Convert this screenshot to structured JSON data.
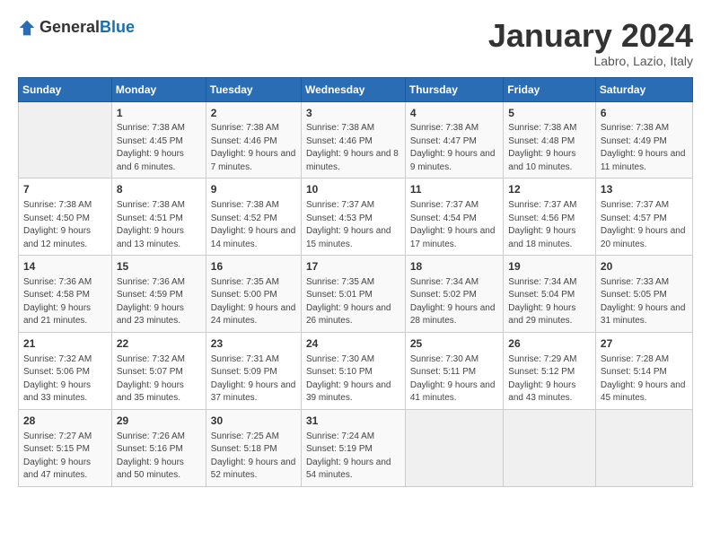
{
  "logo": {
    "general": "General",
    "blue": "Blue"
  },
  "title": "January 2024",
  "subtitle": "Labro, Lazio, Italy",
  "weekdays": [
    "Sunday",
    "Monday",
    "Tuesday",
    "Wednesday",
    "Thursday",
    "Friday",
    "Saturday"
  ],
  "weeks": [
    [
      {
        "day": "",
        "sunrise": "",
        "sunset": "",
        "daylight": ""
      },
      {
        "day": "1",
        "sunrise": "Sunrise: 7:38 AM",
        "sunset": "Sunset: 4:45 PM",
        "daylight": "Daylight: 9 hours and 6 minutes."
      },
      {
        "day": "2",
        "sunrise": "Sunrise: 7:38 AM",
        "sunset": "Sunset: 4:46 PM",
        "daylight": "Daylight: 9 hours and 7 minutes."
      },
      {
        "day": "3",
        "sunrise": "Sunrise: 7:38 AM",
        "sunset": "Sunset: 4:46 PM",
        "daylight": "Daylight: 9 hours and 8 minutes."
      },
      {
        "day": "4",
        "sunrise": "Sunrise: 7:38 AM",
        "sunset": "Sunset: 4:47 PM",
        "daylight": "Daylight: 9 hours and 9 minutes."
      },
      {
        "day": "5",
        "sunrise": "Sunrise: 7:38 AM",
        "sunset": "Sunset: 4:48 PM",
        "daylight": "Daylight: 9 hours and 10 minutes."
      },
      {
        "day": "6",
        "sunrise": "Sunrise: 7:38 AM",
        "sunset": "Sunset: 4:49 PM",
        "daylight": "Daylight: 9 hours and 11 minutes."
      }
    ],
    [
      {
        "day": "7",
        "sunrise": "Sunrise: 7:38 AM",
        "sunset": "Sunset: 4:50 PM",
        "daylight": "Daylight: 9 hours and 12 minutes."
      },
      {
        "day": "8",
        "sunrise": "Sunrise: 7:38 AM",
        "sunset": "Sunset: 4:51 PM",
        "daylight": "Daylight: 9 hours and 13 minutes."
      },
      {
        "day": "9",
        "sunrise": "Sunrise: 7:38 AM",
        "sunset": "Sunset: 4:52 PM",
        "daylight": "Daylight: 9 hours and 14 minutes."
      },
      {
        "day": "10",
        "sunrise": "Sunrise: 7:37 AM",
        "sunset": "Sunset: 4:53 PM",
        "daylight": "Daylight: 9 hours and 15 minutes."
      },
      {
        "day": "11",
        "sunrise": "Sunrise: 7:37 AM",
        "sunset": "Sunset: 4:54 PM",
        "daylight": "Daylight: 9 hours and 17 minutes."
      },
      {
        "day": "12",
        "sunrise": "Sunrise: 7:37 AM",
        "sunset": "Sunset: 4:56 PM",
        "daylight": "Daylight: 9 hours and 18 minutes."
      },
      {
        "day": "13",
        "sunrise": "Sunrise: 7:37 AM",
        "sunset": "Sunset: 4:57 PM",
        "daylight": "Daylight: 9 hours and 20 minutes."
      }
    ],
    [
      {
        "day": "14",
        "sunrise": "Sunrise: 7:36 AM",
        "sunset": "Sunset: 4:58 PM",
        "daylight": "Daylight: 9 hours and 21 minutes."
      },
      {
        "day": "15",
        "sunrise": "Sunrise: 7:36 AM",
        "sunset": "Sunset: 4:59 PM",
        "daylight": "Daylight: 9 hours and 23 minutes."
      },
      {
        "day": "16",
        "sunrise": "Sunrise: 7:35 AM",
        "sunset": "Sunset: 5:00 PM",
        "daylight": "Daylight: 9 hours and 24 minutes."
      },
      {
        "day": "17",
        "sunrise": "Sunrise: 7:35 AM",
        "sunset": "Sunset: 5:01 PM",
        "daylight": "Daylight: 9 hours and 26 minutes."
      },
      {
        "day": "18",
        "sunrise": "Sunrise: 7:34 AM",
        "sunset": "Sunset: 5:02 PM",
        "daylight": "Daylight: 9 hours and 28 minutes."
      },
      {
        "day": "19",
        "sunrise": "Sunrise: 7:34 AM",
        "sunset": "Sunset: 5:04 PM",
        "daylight": "Daylight: 9 hours and 29 minutes."
      },
      {
        "day": "20",
        "sunrise": "Sunrise: 7:33 AM",
        "sunset": "Sunset: 5:05 PM",
        "daylight": "Daylight: 9 hours and 31 minutes."
      }
    ],
    [
      {
        "day": "21",
        "sunrise": "Sunrise: 7:32 AM",
        "sunset": "Sunset: 5:06 PM",
        "daylight": "Daylight: 9 hours and 33 minutes."
      },
      {
        "day": "22",
        "sunrise": "Sunrise: 7:32 AM",
        "sunset": "Sunset: 5:07 PM",
        "daylight": "Daylight: 9 hours and 35 minutes."
      },
      {
        "day": "23",
        "sunrise": "Sunrise: 7:31 AM",
        "sunset": "Sunset: 5:09 PM",
        "daylight": "Daylight: 9 hours and 37 minutes."
      },
      {
        "day": "24",
        "sunrise": "Sunrise: 7:30 AM",
        "sunset": "Sunset: 5:10 PM",
        "daylight": "Daylight: 9 hours and 39 minutes."
      },
      {
        "day": "25",
        "sunrise": "Sunrise: 7:30 AM",
        "sunset": "Sunset: 5:11 PM",
        "daylight": "Daylight: 9 hours and 41 minutes."
      },
      {
        "day": "26",
        "sunrise": "Sunrise: 7:29 AM",
        "sunset": "Sunset: 5:12 PM",
        "daylight": "Daylight: 9 hours and 43 minutes."
      },
      {
        "day": "27",
        "sunrise": "Sunrise: 7:28 AM",
        "sunset": "Sunset: 5:14 PM",
        "daylight": "Daylight: 9 hours and 45 minutes."
      }
    ],
    [
      {
        "day": "28",
        "sunrise": "Sunrise: 7:27 AM",
        "sunset": "Sunset: 5:15 PM",
        "daylight": "Daylight: 9 hours and 47 minutes."
      },
      {
        "day": "29",
        "sunrise": "Sunrise: 7:26 AM",
        "sunset": "Sunset: 5:16 PM",
        "daylight": "Daylight: 9 hours and 50 minutes."
      },
      {
        "day": "30",
        "sunrise": "Sunrise: 7:25 AM",
        "sunset": "Sunset: 5:18 PM",
        "daylight": "Daylight: 9 hours and 52 minutes."
      },
      {
        "day": "31",
        "sunrise": "Sunrise: 7:24 AM",
        "sunset": "Sunset: 5:19 PM",
        "daylight": "Daylight: 9 hours and 54 minutes."
      },
      {
        "day": "",
        "sunrise": "",
        "sunset": "",
        "daylight": ""
      },
      {
        "day": "",
        "sunrise": "",
        "sunset": "",
        "daylight": ""
      },
      {
        "day": "",
        "sunrise": "",
        "sunset": "",
        "daylight": ""
      }
    ]
  ]
}
